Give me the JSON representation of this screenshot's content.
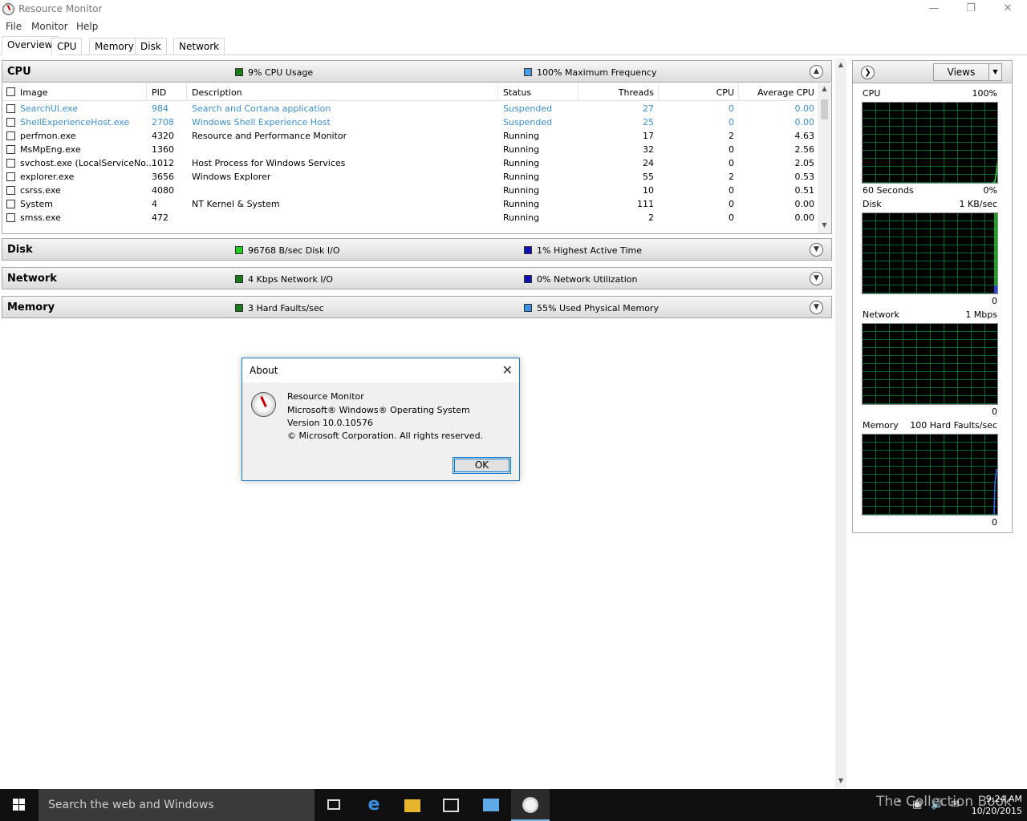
{
  "window": {
    "title": "Resource Monitor"
  },
  "menu": [
    "File",
    "Monitor",
    "Help"
  ],
  "tabs": [
    "Overview",
    "CPU",
    "Memory",
    "Disk",
    "Network"
  ],
  "sections": {
    "cpu": {
      "title": "CPU",
      "metric1": "9% CPU Usage",
      "metric2": "100% Maximum Frequency",
      "color1": "#1a7a1a",
      "color2": "#4a9de0"
    },
    "disk": {
      "title": "Disk",
      "metric1": "96768 B/sec Disk I/O",
      "metric2": "1% Highest Active Time",
      "color1": "#22cc22",
      "color2": "#1010b0"
    },
    "network": {
      "title": "Network",
      "metric1": "4 Kbps Network I/O",
      "metric2": "0% Network Utilization",
      "color1": "#1a7a1a",
      "color2": "#1010b0"
    },
    "memory": {
      "title": "Memory",
      "metric1": "3 Hard Faults/sec",
      "metric2": "55% Used Physical Memory",
      "color1": "#1a7a1a",
      "color2": "#3a8fe0"
    }
  },
  "cpu_table": {
    "columns": [
      "Image",
      "PID",
      "Description",
      "Status",
      "Threads",
      "CPU",
      "Average CPU"
    ],
    "rows": [
      {
        "image": "SearchUI.exe",
        "pid": "984",
        "desc": "Search and Cortana application",
        "status": "Suspended",
        "threads": "27",
        "cpu": "0",
        "avg": "0.00"
      },
      {
        "image": "ShellExperienceHost.exe",
        "pid": "2708",
        "desc": "Windows Shell Experience Host",
        "status": "Suspended",
        "threads": "25",
        "cpu": "0",
        "avg": "0.00"
      },
      {
        "image": "perfmon.exe",
        "pid": "4320",
        "desc": "Resource and Performance Monitor",
        "status": "Running",
        "threads": "17",
        "cpu": "2",
        "avg": "4.63"
      },
      {
        "image": "MsMpEng.exe",
        "pid": "1360",
        "desc": "",
        "status": "Running",
        "threads": "32",
        "cpu": "0",
        "avg": "2.56"
      },
      {
        "image": "svchost.exe (LocalServiceNo...",
        "pid": "1012",
        "desc": "Host Process for Windows Services",
        "status": "Running",
        "threads": "24",
        "cpu": "0",
        "avg": "2.05"
      },
      {
        "image": "explorer.exe",
        "pid": "3656",
        "desc": "Windows Explorer",
        "status": "Running",
        "threads": "55",
        "cpu": "2",
        "avg": "0.53"
      },
      {
        "image": "csrss.exe",
        "pid": "4080",
        "desc": "",
        "status": "Running",
        "threads": "10",
        "cpu": "0",
        "avg": "0.51"
      },
      {
        "image": "System",
        "pid": "4",
        "desc": "NT Kernel & System",
        "status": "Running",
        "threads": "111",
        "cpu": "0",
        "avg": "0.00"
      },
      {
        "image": "smss.exe",
        "pid": "472",
        "desc": "",
        "status": "Running",
        "threads": "2",
        "cpu": "0",
        "avg": "0.00"
      }
    ]
  },
  "right_pane": {
    "views_label": "Views",
    "graphs": [
      {
        "name": "CPU",
        "max": "100%",
        "bottom_left": "60 Seconds",
        "bottom_right": "0%"
      },
      {
        "name": "Disk",
        "max": "1 KB/sec",
        "bottom_left": "",
        "bottom_right": "0"
      },
      {
        "name": "Network",
        "max": "1 Mbps",
        "bottom_left": "",
        "bottom_right": "0"
      },
      {
        "name": "Memory",
        "max": "100 Hard Faults/sec",
        "bottom_left": "",
        "bottom_right": "0"
      }
    ]
  },
  "dialog": {
    "title": "About",
    "lines": [
      "Resource Monitor",
      "Microsoft® Windows® Operating System",
      "Version 10.0.10576",
      "© Microsoft Corporation. All rights reserved."
    ],
    "ok_label": "OK"
  },
  "taskbar": {
    "search_placeholder": "Search the web and Windows",
    "watermark": "The Collection Book",
    "time": "9:24 AM",
    "date": "10/20/2015"
  }
}
